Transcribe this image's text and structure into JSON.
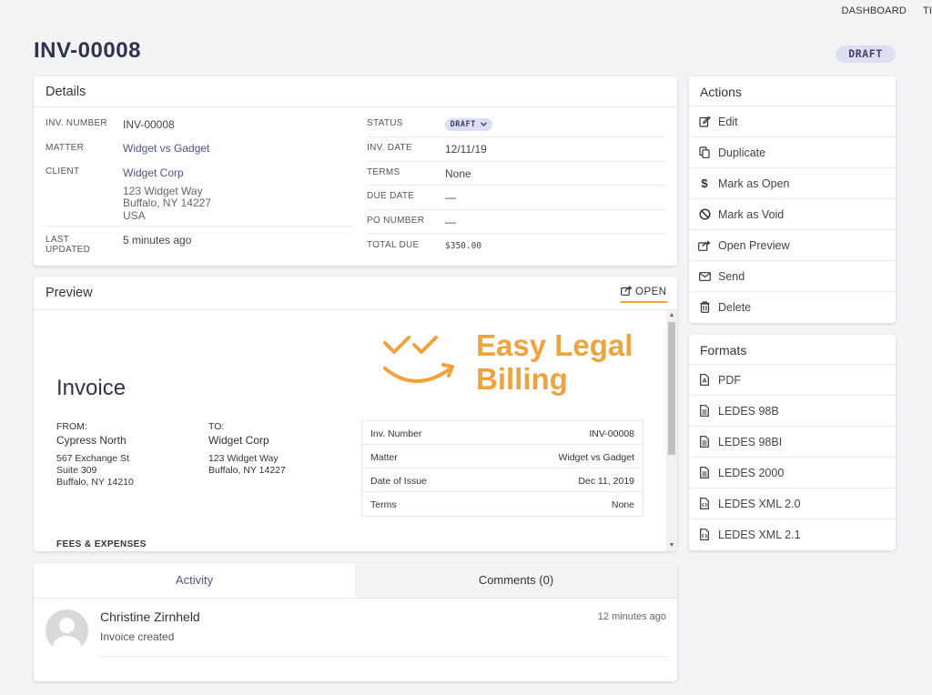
{
  "topnav": {
    "dashboard": "DASHBOARD",
    "clipped": "TI"
  },
  "page": {
    "title": "INV-00008",
    "status_badge": "DRAFT"
  },
  "details": {
    "title": "Details",
    "left": [
      {
        "label": "INV. NUMBER",
        "value": "INV-00008"
      },
      {
        "label": "MATTER",
        "value": "Widget vs Gadget"
      },
      {
        "label": "CLIENT",
        "value": "Widget Corp",
        "address1": "123 Widget Way",
        "address2": "Buffalo, NY 14227",
        "address3": "USA"
      },
      {
        "label1": "LAST",
        "label2": "UPDATED",
        "value": "5 minutes ago"
      }
    ],
    "right": [
      {
        "label": "STATUS",
        "value": "DRAFT"
      },
      {
        "label": "INV. DATE",
        "value": "12/11/19"
      },
      {
        "label": "TERMS",
        "value": "None"
      },
      {
        "label": "DUE DATE",
        "value": "—"
      },
      {
        "label": "PO NUMBER",
        "value": "—"
      },
      {
        "label": "TOTAL DUE",
        "value": "$350.00"
      }
    ]
  },
  "preview": {
    "title": "Preview",
    "open_label": "OPEN",
    "doc": {
      "heading": "Invoice",
      "brand_line1": "Easy Legal",
      "brand_line2": "Billing",
      "from_label": "FROM:",
      "from_name": "Cypress North",
      "from_addr1": "567 Exchange St",
      "from_addr2": "Suite 309",
      "from_addr3": "Buffalo, NY 14210",
      "to_label": "TO:",
      "to_name": "Widget Corp",
      "to_addr1": "123 Widget Way",
      "to_addr2": "Buffalo, NY 14227",
      "table": [
        {
          "k": "Inv. Number",
          "v": "INV-00008"
        },
        {
          "k": "Matter",
          "v": "Widget vs Gadget"
        },
        {
          "k": "Date of Issue",
          "v": "Dec 11, 2019"
        },
        {
          "k": "Terms",
          "v": "None"
        }
      ],
      "fees_heading": "FEES & EXPENSES"
    }
  },
  "activity": {
    "tabs": [
      "Activity",
      "Comments (0)"
    ],
    "entries": [
      {
        "name": "Christine Zirnheld",
        "text": "Invoice created",
        "time": "12 minutes ago"
      }
    ]
  },
  "actions": {
    "title": "Actions",
    "items": [
      {
        "label": "Edit",
        "icon": "edit-icon"
      },
      {
        "label": "Duplicate",
        "icon": "copy-icon"
      },
      {
        "label": "Mark as Open",
        "icon": "dollar-icon"
      },
      {
        "label": "Mark as Void",
        "icon": "ban-icon"
      },
      {
        "label": "Open Preview",
        "icon": "external-link-icon"
      },
      {
        "label": "Send",
        "icon": "envelope-icon"
      },
      {
        "label": "Delete",
        "icon": "trash-icon"
      }
    ]
  },
  "formats": {
    "title": "Formats",
    "items": [
      {
        "label": "PDF",
        "icon": "pdf-file-icon"
      },
      {
        "label": "LEDES 98B",
        "icon": "file-text-icon"
      },
      {
        "label": "LEDES 98BI",
        "icon": "file-text-icon"
      },
      {
        "label": "LEDES 2000",
        "icon": "file-text-icon"
      },
      {
        "label": "LEDES XML 2.0",
        "icon": "file-code-icon"
      },
      {
        "label": "LEDES XML 2.1",
        "icon": "file-code-icon"
      }
    ]
  },
  "colors": {
    "accent": "#4c5391",
    "brand_orange": "#f0a33b",
    "title": "#2e3350",
    "badge_bg": "#dcdff1"
  }
}
